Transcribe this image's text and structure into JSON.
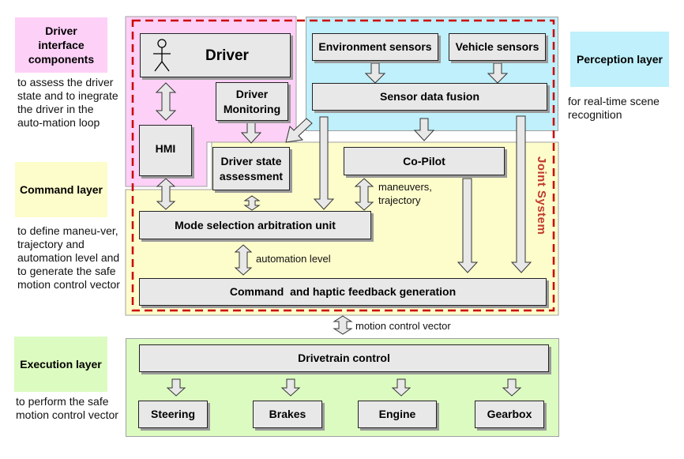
{
  "colors": {
    "driver_layer": "#fdd0f7",
    "perception_layer": "#bff0fb",
    "command_layer": "#fdfccb",
    "execution_layer": "#dcfbc0",
    "node_fill": "#e8e8e8",
    "joint_system_border": "#cc0000"
  },
  "legend": {
    "driver": {
      "title": "Driver interface components",
      "description": "to assess the driver state and to inegrate the driver in the auto-mation loop"
    },
    "command": {
      "title": "Command layer",
      "description": "to define maneu-ver, trajectory and automation level and to generate the safe motion control vector"
    },
    "execution": {
      "title": "Execution layer",
      "description": "to perform the safe motion control vector"
    },
    "perception": {
      "title": "Perception layer",
      "description": "for real-time scene recognition"
    }
  },
  "nodes": {
    "driver": "Driver",
    "driver_icon": "stick-figure-icon",
    "driver_monitoring": "Driver Monitoring",
    "hmi": "HMI",
    "driver_state_assessment": "Driver state assessment",
    "environment_sensors": "Environment sensors",
    "vehicle_sensors": "Vehicle sensors",
    "sensor_data_fusion": "Sensor data fusion",
    "co_pilot": "Co-Pilot",
    "mode_selection": "Mode selection arbitration unit",
    "command_generation": "Command  and haptic feedback generation",
    "drivetrain_control": "Drivetrain control",
    "steering": "Steering",
    "brakes": "Brakes",
    "engine": "Engine",
    "gearbox": "Gearbox"
  },
  "edge_labels": {
    "maneuvers": "maneuvers, trajectory",
    "automation_level": "automation level",
    "motion_control_vector": "motion control vector"
  },
  "joint_system_label": "Joint System"
}
